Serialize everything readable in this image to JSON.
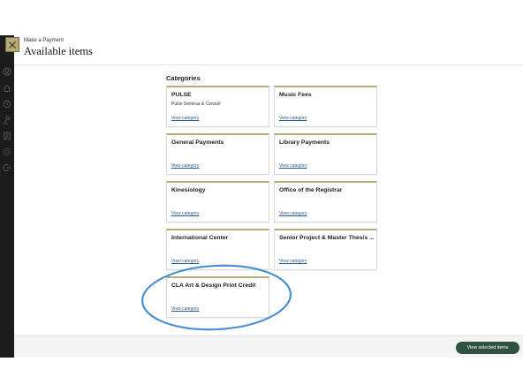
{
  "header": {
    "kicker": "Make a Payment",
    "title": "Available items"
  },
  "categories": {
    "heading": "Categories",
    "link_label": "View category",
    "items": [
      {
        "title": "PULSE",
        "subtitle": "Pulse Seminar & Consult"
      },
      {
        "title": "Music Fees",
        "subtitle": ""
      },
      {
        "title": "General Payments",
        "subtitle": ""
      },
      {
        "title": "Library Payments",
        "subtitle": ""
      },
      {
        "title": "Kinesiology",
        "subtitle": ""
      },
      {
        "title": "Office of the Registrar",
        "subtitle": ""
      },
      {
        "title": "International Center",
        "subtitle": ""
      },
      {
        "title": "Senior Project & Master Thesis ...",
        "subtitle": ""
      },
      {
        "title": "CLA Art & Design Print Credit",
        "subtitle": ""
      }
    ]
  },
  "footer": {
    "view_selected_label": "View selected items"
  },
  "colors": {
    "accent_gold": "#b5aa78",
    "button_green": "#2f5242",
    "link_blue": "#2a5d8f",
    "annotation_blue": "#4a90d0",
    "rail_dark": "#1c1c1c"
  },
  "rail_icons": [
    "user-icon",
    "home-icon",
    "history-icon",
    "gavel-icon",
    "ledger-icon",
    "help-icon",
    "logout-icon"
  ]
}
